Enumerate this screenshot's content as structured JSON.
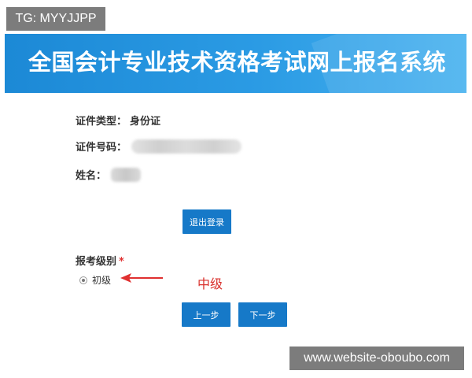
{
  "overlay": {
    "tag": "TG: MYYJJPP",
    "watermark": "www.website-oboubo.com"
  },
  "header": {
    "title": "全国会计专业技术资格考试网上报名系统"
  },
  "info": {
    "id_type_label": "证件类型：",
    "id_type_value": "身份证",
    "id_number_label": "证件号码：",
    "name_label": "姓名："
  },
  "buttons": {
    "logout": "退出登录",
    "prev": "上一步",
    "next": "下一步"
  },
  "exam_level": {
    "label": "报考级别",
    "required_mark": "*",
    "options": [
      {
        "label": "初级",
        "selected": true
      }
    ]
  },
  "annotation": {
    "text": "中级",
    "color": "#d9302c"
  },
  "colors": {
    "header_blue": "#1c89d6",
    "button_blue": "#1679c8",
    "required_red": "#e03030"
  }
}
